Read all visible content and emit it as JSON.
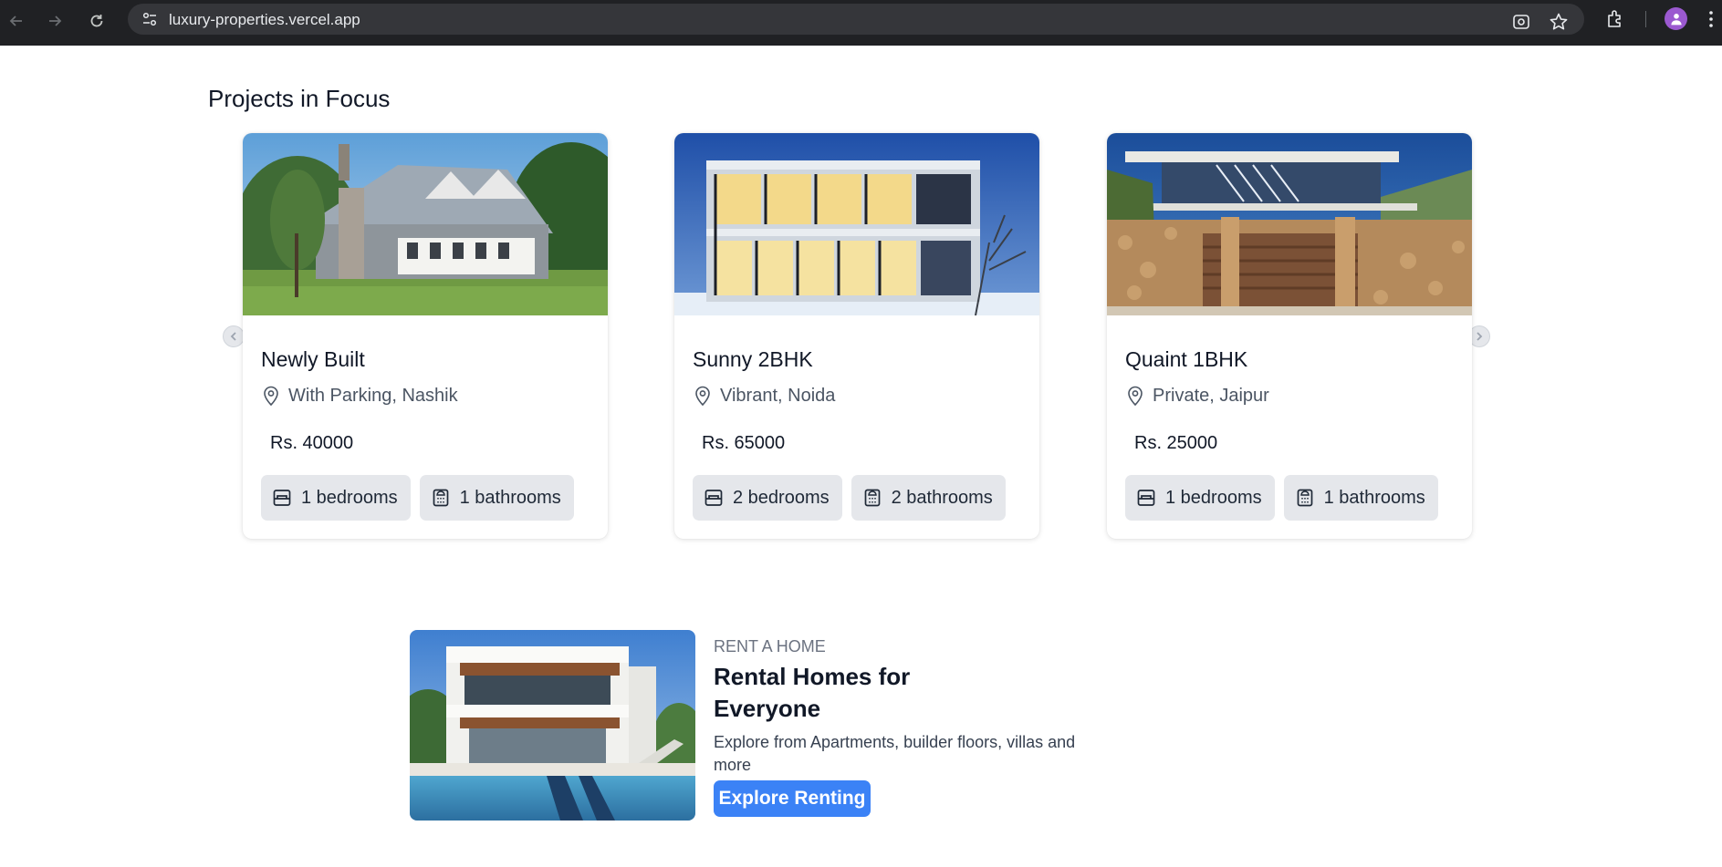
{
  "browser": {
    "url": "luxury-properties.vercel.app"
  },
  "page": {
    "section_title": "Projects in Focus"
  },
  "cards": [
    {
      "title": "Newly Built",
      "location": "With Parking, Nashik",
      "price": "Rs. 40000",
      "bedrooms": "1 bedrooms",
      "bathrooms": "1 bathrooms"
    },
    {
      "title": "Sunny 2BHK",
      "location": "Vibrant, Noida",
      "price": "Rs. 65000",
      "bedrooms": "2 bedrooms",
      "bathrooms": "2 bathrooms"
    },
    {
      "title": "Quaint 1BHK",
      "location": "Private, Jaipur",
      "price": "Rs. 25000",
      "bedrooms": "1 bedrooms",
      "bathrooms": "1 bathrooms"
    }
  ],
  "rent": {
    "eyebrow": "RENT A HOME",
    "title": "Rental Homes for Everyone",
    "description": "Explore from Apartments, builder floors, villas and more",
    "button_label": "Explore Renting"
  },
  "colors": {
    "accent": "#3b82f6",
    "chip_bg": "#e5e7eb",
    "chrome_bg": "#202124"
  }
}
